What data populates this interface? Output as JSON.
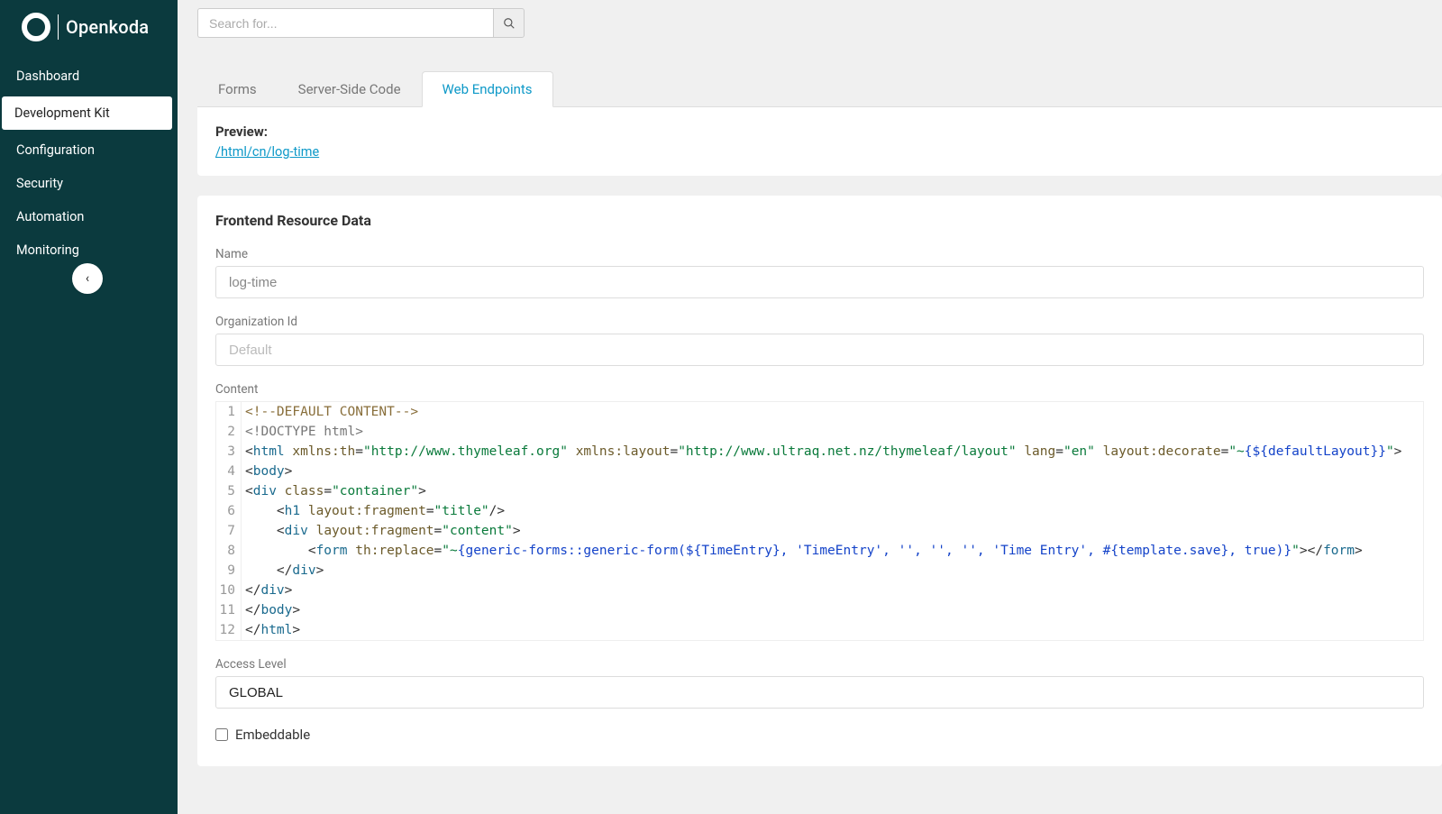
{
  "brand": "Openkoda",
  "search": {
    "placeholder": "Search for..."
  },
  "nav": {
    "items": [
      {
        "label": "Dashboard",
        "active": false
      },
      {
        "label": "Development Kit",
        "active": true
      },
      {
        "label": "Configuration",
        "active": false
      },
      {
        "label": "Security",
        "active": false
      },
      {
        "label": "Automation",
        "active": false
      },
      {
        "label": "Monitoring",
        "active": false
      }
    ]
  },
  "tabs": [
    {
      "label": "Forms",
      "active": false
    },
    {
      "label": "Server-Side Code",
      "active": false
    },
    {
      "label": "Web Endpoints",
      "active": true
    }
  ],
  "preview": {
    "label": "Preview:",
    "link": "/html/cn/log-time"
  },
  "form": {
    "title": "Frontend Resource Data",
    "name_label": "Name",
    "name_value": "log-time",
    "org_label": "Organization Id",
    "org_value": "Default",
    "content_label": "Content",
    "access_label": "Access Level",
    "access_value": "GLOBAL",
    "embeddable_label": "Embeddable",
    "embeddable_checked": false
  },
  "code": {
    "lines": [
      {
        "n": 1,
        "tokens": [
          {
            "t": "<!--DEFAULT CONTENT-->",
            "c": "c-comment"
          }
        ]
      },
      {
        "n": 2,
        "tokens": [
          {
            "t": "<!DOCTYPE html>",
            "c": "c-doctype"
          }
        ]
      },
      {
        "n": 3,
        "tokens": [
          {
            "t": "<",
            "c": "c-punct"
          },
          {
            "t": "html",
            "c": "c-tag"
          },
          {
            "t": " ",
            "c": ""
          },
          {
            "t": "xmlns:th",
            "c": "c-attr"
          },
          {
            "t": "=",
            "c": "c-eq"
          },
          {
            "t": "\"http://www.thymeleaf.org\"",
            "c": "c-string"
          },
          {
            "t": " ",
            "c": ""
          },
          {
            "t": "xmlns:layout",
            "c": "c-attr"
          },
          {
            "t": "=",
            "c": "c-eq"
          },
          {
            "t": "\"http://www.ultraq.net.nz/thymeleaf/layout\"",
            "c": "c-string"
          },
          {
            "t": " ",
            "c": ""
          },
          {
            "t": "lang",
            "c": "c-attr"
          },
          {
            "t": "=",
            "c": "c-eq"
          },
          {
            "t": "\"en\"",
            "c": "c-string"
          },
          {
            "t": " ",
            "c": ""
          },
          {
            "t": "layout:decorate",
            "c": "c-attr"
          },
          {
            "t": "=",
            "c": "c-eq"
          },
          {
            "t": "\"~",
            "c": "c-string"
          },
          {
            "t": "{",
            "c": "c-expr"
          },
          {
            "t": "${defaultLayout}",
            "c": "c-expr"
          },
          {
            "t": "}",
            "c": "c-expr"
          },
          {
            "t": "\"",
            "c": "c-string"
          },
          {
            "t": ">",
            "c": "c-punct"
          }
        ]
      },
      {
        "n": 4,
        "tokens": [
          {
            "t": "<",
            "c": "c-punct"
          },
          {
            "t": "body",
            "c": "c-tag"
          },
          {
            "t": ">",
            "c": "c-punct"
          }
        ]
      },
      {
        "n": 5,
        "tokens": [
          {
            "t": "<",
            "c": "c-punct"
          },
          {
            "t": "div",
            "c": "c-tag"
          },
          {
            "t": " ",
            "c": ""
          },
          {
            "t": "class",
            "c": "c-attr"
          },
          {
            "t": "=",
            "c": "c-eq"
          },
          {
            "t": "\"container\"",
            "c": "c-string"
          },
          {
            "t": ">",
            "c": "c-punct"
          }
        ]
      },
      {
        "n": 6,
        "tokens": [
          {
            "t": "    ",
            "c": ""
          },
          {
            "t": "<",
            "c": "c-punct"
          },
          {
            "t": "h1",
            "c": "c-tag"
          },
          {
            "t": " ",
            "c": ""
          },
          {
            "t": "layout:fragment",
            "c": "c-attr"
          },
          {
            "t": "=",
            "c": "c-eq"
          },
          {
            "t": "\"title\"",
            "c": "c-string"
          },
          {
            "t": "/>",
            "c": "c-punct"
          }
        ]
      },
      {
        "n": 7,
        "tokens": [
          {
            "t": "    ",
            "c": ""
          },
          {
            "t": "<",
            "c": "c-punct"
          },
          {
            "t": "div",
            "c": "c-tag"
          },
          {
            "t": " ",
            "c": ""
          },
          {
            "t": "layout:fragment",
            "c": "c-attr"
          },
          {
            "t": "=",
            "c": "c-eq"
          },
          {
            "t": "\"content\"",
            "c": "c-string"
          },
          {
            "t": ">",
            "c": "c-punct"
          }
        ]
      },
      {
        "n": 8,
        "tokens": [
          {
            "t": "        ",
            "c": ""
          },
          {
            "t": "<",
            "c": "c-punct"
          },
          {
            "t": "form",
            "c": "c-tag"
          },
          {
            "t": " ",
            "c": ""
          },
          {
            "t": "th:replace",
            "c": "c-attr"
          },
          {
            "t": "=",
            "c": "c-eq"
          },
          {
            "t": "\"~",
            "c": "c-string"
          },
          {
            "t": "{",
            "c": "c-expr"
          },
          {
            "t": "generic-forms::generic-form(${TimeEntry}, 'TimeEntry', '', '', '', 'Time Entry', #{template.save}, true)",
            "c": "c-expr"
          },
          {
            "t": "}",
            "c": "c-expr"
          },
          {
            "t": "\"",
            "c": "c-string"
          },
          {
            "t": ">",
            "c": "c-punct"
          },
          {
            "t": "</",
            "c": "c-punct"
          },
          {
            "t": "form",
            "c": "c-tag"
          },
          {
            "t": ">",
            "c": "c-punct"
          }
        ]
      },
      {
        "n": 9,
        "tokens": [
          {
            "t": "    ",
            "c": ""
          },
          {
            "t": "</",
            "c": "c-punct"
          },
          {
            "t": "div",
            "c": "c-tag"
          },
          {
            "t": ">",
            "c": "c-punct"
          }
        ]
      },
      {
        "n": 10,
        "tokens": [
          {
            "t": "</",
            "c": "c-punct"
          },
          {
            "t": "div",
            "c": "c-tag"
          },
          {
            "t": ">",
            "c": "c-punct"
          }
        ]
      },
      {
        "n": 11,
        "tokens": [
          {
            "t": "</",
            "c": "c-punct"
          },
          {
            "t": "body",
            "c": "c-tag"
          },
          {
            "t": ">",
            "c": "c-punct"
          }
        ]
      },
      {
        "n": 12,
        "tokens": [
          {
            "t": "</",
            "c": "c-punct"
          },
          {
            "t": "html",
            "c": "c-tag"
          },
          {
            "t": ">",
            "c": "c-punct"
          }
        ]
      }
    ]
  }
}
